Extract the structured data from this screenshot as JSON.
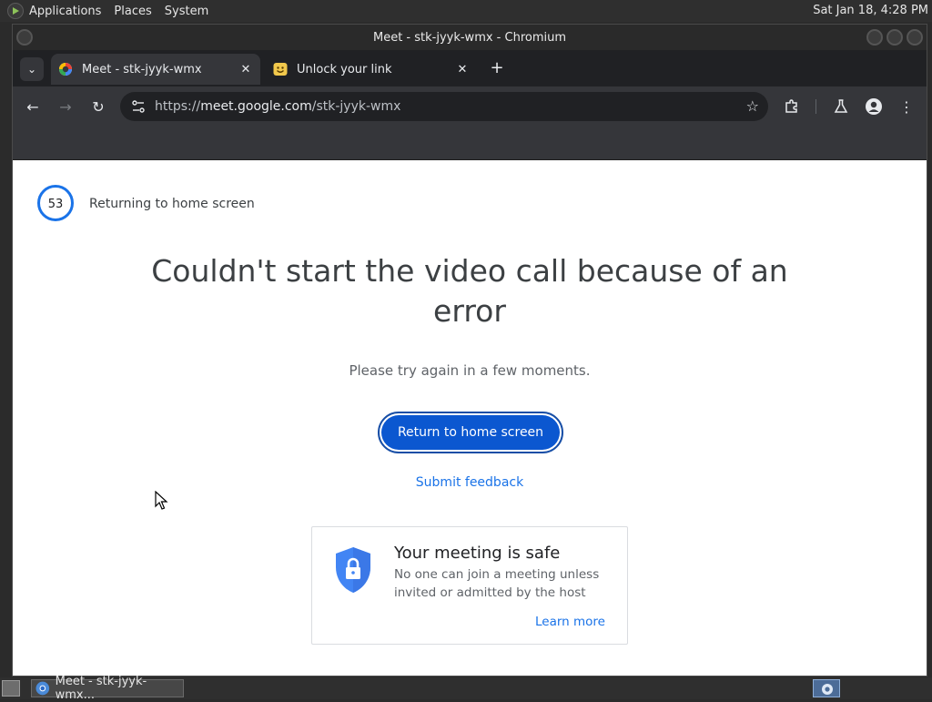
{
  "panel": {
    "menus": [
      "Applications",
      "Places",
      "System"
    ],
    "clock": "Sat Jan 18,  4:28 PM"
  },
  "window": {
    "title": "Meet - stk-jyyk-wmx - Chromium"
  },
  "tabs": [
    {
      "label": "Meet - stk-jyyk-wmx",
      "icon": "google-meet-icon",
      "active": true
    },
    {
      "label": "Unlock your link",
      "icon": "smiley-icon",
      "active": false
    }
  ],
  "omnibox": {
    "scheme": "https://",
    "host": "meet.google.com",
    "path": "/stk-jyyk-wmx"
  },
  "page": {
    "countdown": "53",
    "countdown_label": "Returning to home screen",
    "heading": "Couldn't start the video call because of an error",
    "subtext": "Please try again in a few moments.",
    "primary_button": "Return to home screen",
    "feedback_link": "Submit feedback",
    "safe_card": {
      "title": "Your meeting is safe",
      "description": "No one can join a meeting unless invited or admitted by the host",
      "learn_more": "Learn more"
    }
  },
  "taskbar": {
    "task_label": "Meet - stk-jyyk-wmx..."
  },
  "colors": {
    "accent": "#0b57d0",
    "link": "#1a73e8",
    "countdown_ring": "#1a73e8"
  }
}
